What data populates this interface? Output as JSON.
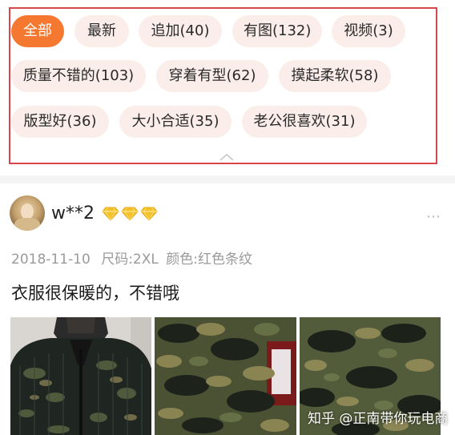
{
  "filter_tags": [
    {
      "label": "全部",
      "active": true
    },
    {
      "label": "最新",
      "active": false
    },
    {
      "label": "追加(40)",
      "active": false
    },
    {
      "label": "有图(132)",
      "active": false
    },
    {
      "label": "视频(3)",
      "active": false
    },
    {
      "label": "质量不错的(103)",
      "active": false
    },
    {
      "label": "穿着有型(62)",
      "active": false
    },
    {
      "label": "摸起柔软(58)",
      "active": false
    },
    {
      "label": "版型好(36)",
      "active": false
    },
    {
      "label": "大小合适(35)",
      "active": false
    },
    {
      "label": "老公很喜欢(31)",
      "active": false
    }
  ],
  "review": {
    "username": "w**2",
    "date": "2018-11-10",
    "size_spec": "尺码:2XL",
    "color_spec": "颜色:红色条纹",
    "comment": "衣服很保暖的，不错哦",
    "more_icon": "⋯"
  },
  "watermark": "知乎 @正南带你玩电商",
  "colors": {
    "accent": "#f4782f",
    "tag_bg": "#fbeeea",
    "highlight_border": "#d7464b",
    "diamond": "#f5c02a"
  }
}
